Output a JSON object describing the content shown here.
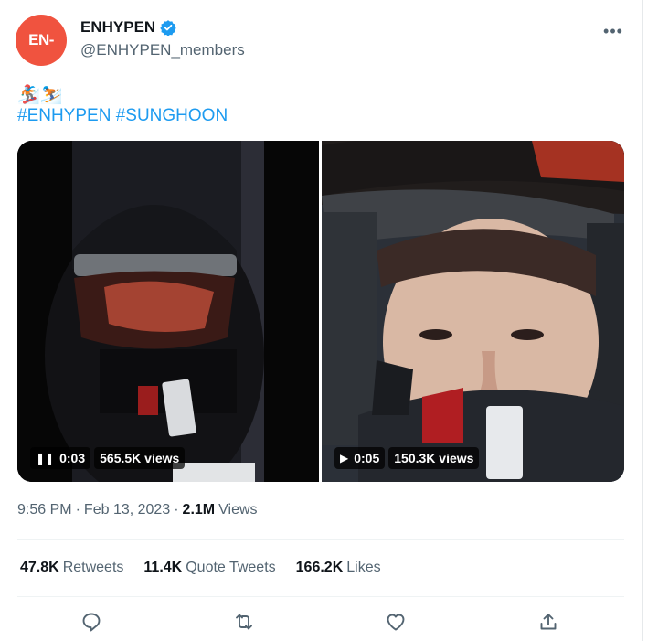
{
  "tweet": {
    "author": {
      "display_name": "ENHYPEN",
      "handle": "@ENHYPEN_members",
      "avatar_text": "EN-",
      "verified": true,
      "brand_color": "#f0533f"
    },
    "more_icon": "more-horizontal-icon",
    "emoji": "🏂⛷️",
    "hashtags": [
      "#ENHYPEN",
      "#SUNGHOON"
    ],
    "media": [
      {
        "state_icon": "pause-icon",
        "duration": "0:03",
        "views": "565.5K views"
      },
      {
        "state_icon": "play-icon",
        "duration": "0:05",
        "views": "150.3K views"
      }
    ],
    "meta": {
      "time": "9:56 PM",
      "separator": "·",
      "date": "Feb 13, 2023",
      "views_count": "2.1M",
      "views_label": "Views"
    },
    "stats": [
      {
        "count": "47.8K",
        "label": "Retweets"
      },
      {
        "count": "11.4K",
        "label": "Quote Tweets"
      },
      {
        "count": "166.2K",
        "label": "Likes"
      }
    ],
    "actions": [
      "reply-icon",
      "retweet-icon",
      "like-icon",
      "share-icon"
    ],
    "colors": {
      "link": "#1d9bf0",
      "secondary_text": "#536471",
      "primary_text": "#0f1419",
      "divider": "#eff3f4"
    }
  }
}
